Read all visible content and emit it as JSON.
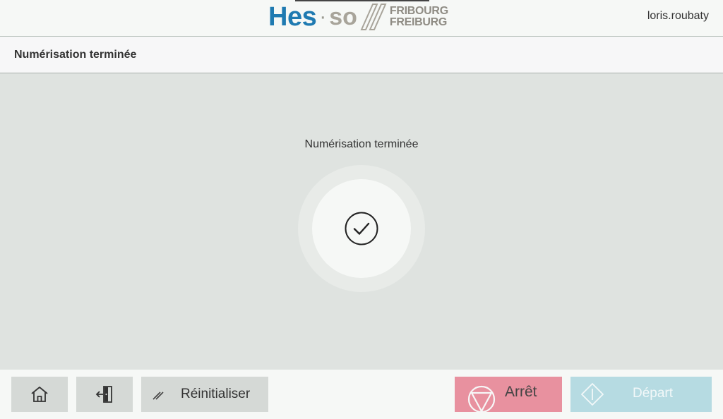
{
  "header": {
    "logo": {
      "brand": "Hes",
      "dot": "·",
      "suffix": "so",
      "city_fr": "FRIBOURG",
      "city_de": "FREIBURG"
    },
    "username": "loris.roubaty"
  },
  "titlebar": {
    "title": "Numérisation terminée"
  },
  "main": {
    "status_text": "Numérisation terminée",
    "status_icon": "checkmark-icon"
  },
  "footer": {
    "home_icon": "home-icon",
    "logout_icon": "logout-icon",
    "reset_label": "Réinitialiser",
    "stop_label": "Arrêt",
    "start_label": "Départ"
  },
  "colors": {
    "brand_blue": "#1f7ab1",
    "stop_button": "#e8919f",
    "start_button_disabled": "#b6dbe2",
    "main_background": "#dfe3e0"
  }
}
